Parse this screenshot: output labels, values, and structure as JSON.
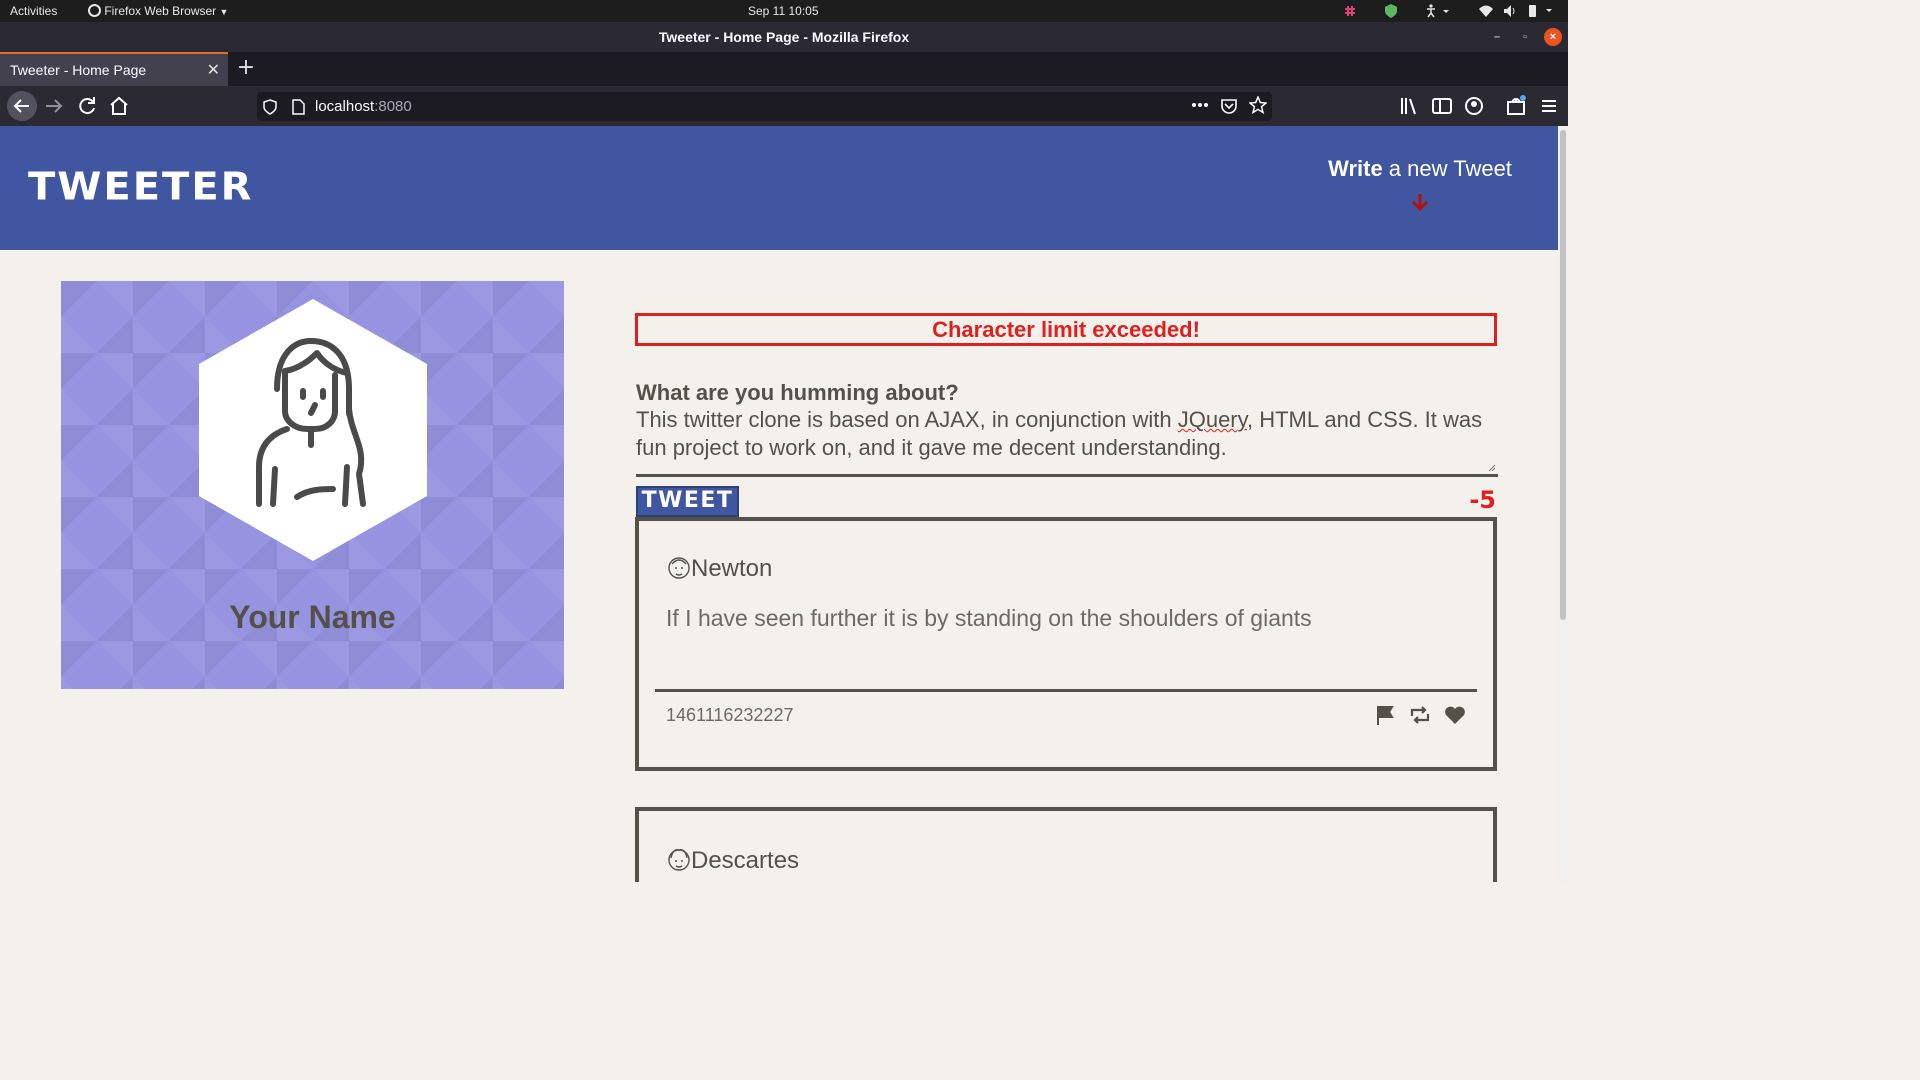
{
  "system_bar": {
    "activities": "Activities",
    "app_menu": "Firefox Web Browser",
    "clock": "Sep 11  10:05"
  },
  "window": {
    "title": "Tweeter - Home Page - Mozilla Firefox"
  },
  "browser": {
    "tab_title": "Tweeter - Home Page",
    "url_host": "localhost",
    "url_port": ":8080"
  },
  "site": {
    "logo": "TWEETER",
    "compose_bold": "Write",
    "compose_rest": " a new Tweet"
  },
  "profile": {
    "name": "Your Name"
  },
  "composer": {
    "error": "Character limit exceeded!",
    "prompt": "What are you humming about?",
    "text_before_spell": "This twitter clone is based on AJAX, in conjunction with ",
    "spell_word": "JQuery",
    "text_after_spell": ", HTML and CSS. It was fun project to work on, and it gave me decent understanding.",
    "button": "TWEET",
    "counter": "-5"
  },
  "tweets": [
    {
      "author": "Newton",
      "content": "If I have seen further it is by standing on the shoulders of giants",
      "timestamp": "1461116232227"
    },
    {
      "author": "Descartes"
    }
  ],
  "colors": {
    "nav_bg": "#4056a1",
    "error": "#e02020",
    "profile_bg": "#9693e0",
    "text": "#545149",
    "page_bg": "#f4f1ec"
  }
}
